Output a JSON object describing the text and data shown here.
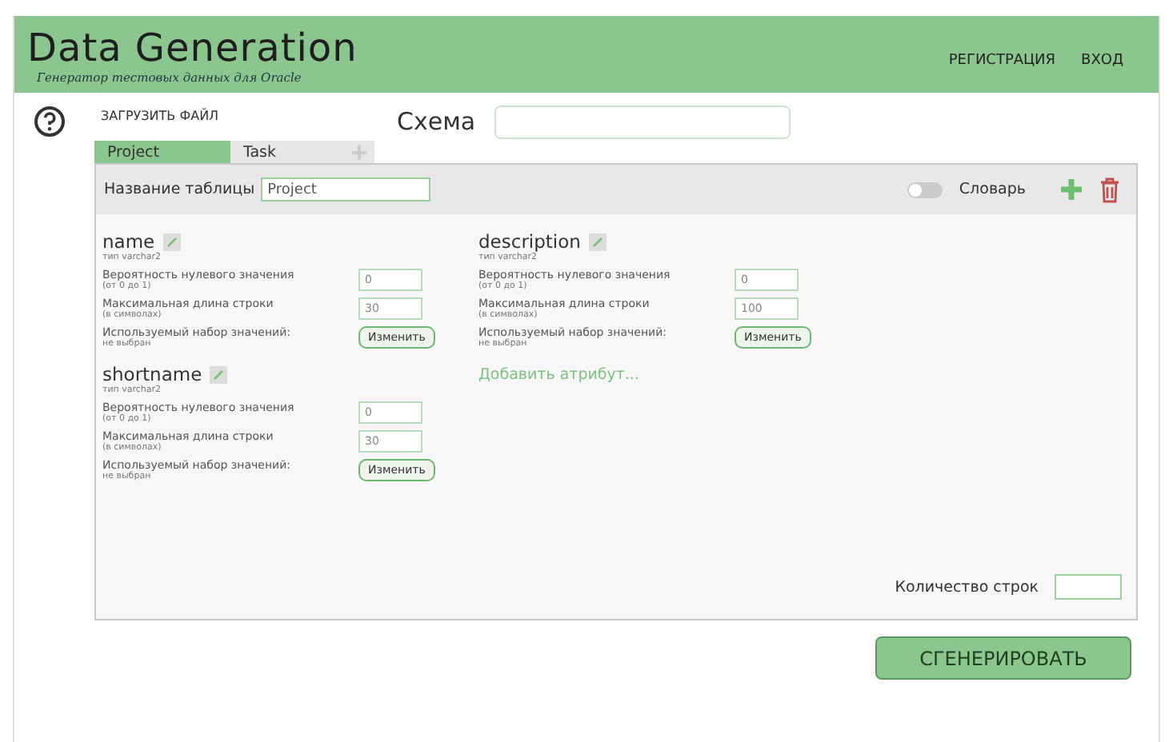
{
  "header": {
    "title": "Data Generation",
    "subtitle": "Генератор тестовых данных для Oracle",
    "nav": [
      "РЕГИСТРАЦИЯ",
      "ВХОД"
    ]
  },
  "toolbar": {
    "upload": "ЗАГРУЗИТЬ ФАЙЛ",
    "schema_label": "Схема"
  },
  "tabs": [
    {
      "label": "Project",
      "selected": true
    },
    {
      "label": "Task",
      "selected": false
    }
  ],
  "table": {
    "name_label": "Название таблицы",
    "name_value": "Project",
    "dictionary": {
      "label": "Словарь",
      "on": false
    },
    "columns": [
      {
        "attributes": [
          {
            "name": "name",
            "type": "тип varchar2",
            "null_label": "Вероятность нулевого значения",
            "null_note": "(от 0 до 1)",
            "null_value": "0",
            "len_label": "Максимальная длина строки",
            "len_note": "(в символах)",
            "len_value": "30",
            "set_label": "Используемый набор значений:",
            "set_note": "не выбран",
            "set_button": "Изменить"
          },
          {
            "name": "shortname",
            "type": "тип varchar2",
            "null_label": "Вероятность нулевого значения",
            "null_note": "(от 0 до 1)",
            "null_value": "0",
            "len_label": "Максимальная длина строки",
            "len_note": "(в символах)",
            "len_value": "30",
            "set_label": "Используемый набор значений:",
            "set_note": "не выбран",
            "set_button": "Изменить"
          }
        ]
      },
      {
        "attributes": [
          {
            "name": "description",
            "type": "тип varchar2",
            "null_label": "Вероятность нулевого значения",
            "null_note": "(от 0 до 1)",
            "null_value": "0",
            "len_label": "Максимальная длина строки",
            "len_note": "(в символах)",
            "len_value": "100",
            "set_label": "Используемый набор значений:",
            "set_note": "не выбран",
            "set_button": "Изменить"
          }
        ],
        "add_link": "Добавить атрибут..."
      }
    ],
    "rows_label": "Количество строк"
  },
  "generate_button": "СГЕНЕРИРОВАТЬ"
}
